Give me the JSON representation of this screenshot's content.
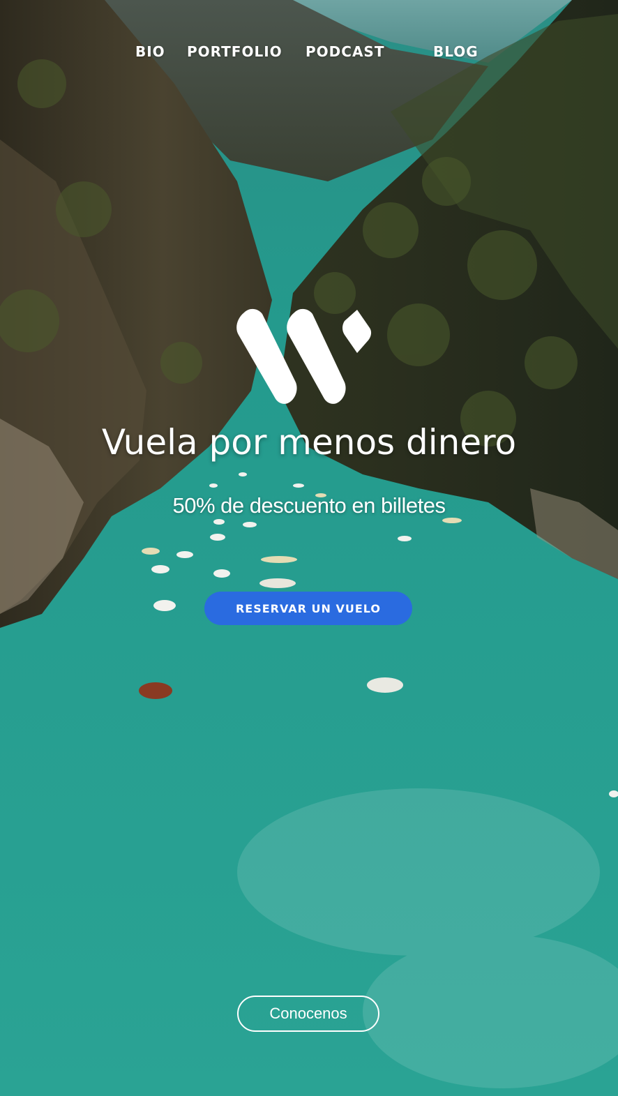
{
  "nav": {
    "items": [
      {
        "label": "BIO"
      },
      {
        "label": "PORTFOLIO"
      },
      {
        "label": "PODCAST"
      },
      {
        "label": "BLOG"
      }
    ]
  },
  "hero": {
    "logo_icon": "brand-w-logo",
    "headline": "Vuela por menos dinero",
    "subheadline": "50% de descuento en billetes",
    "primary_cta": "RESERVAR UN VUELO",
    "secondary_cta": "Conocenos"
  },
  "colors": {
    "primary_button": "#2a6be0",
    "text": "#ffffff",
    "water": "#23a092"
  }
}
